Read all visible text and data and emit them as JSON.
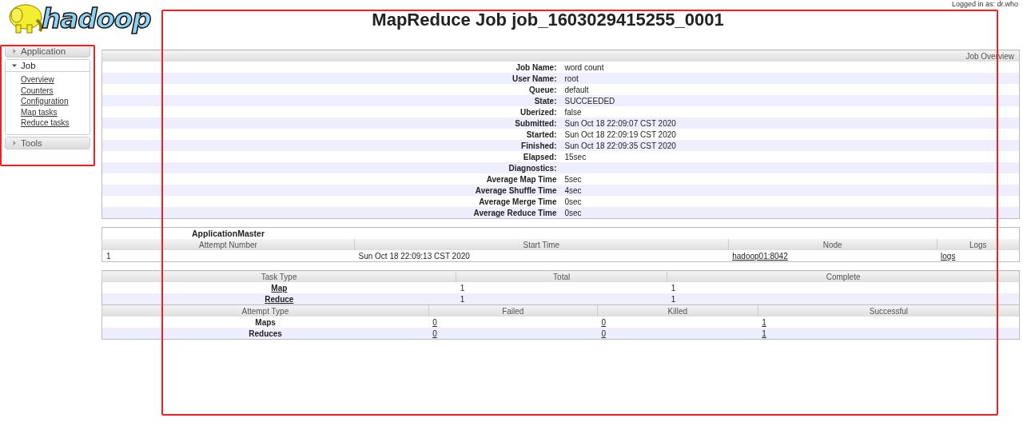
{
  "logo": {
    "text": "hadoop"
  },
  "user": {
    "text": "Logged in as: dr.who"
  },
  "title": "MapReduce Job job_1603029415255_0001",
  "sidebar": [
    {
      "label": "Application",
      "expanded": false
    },
    {
      "label": "Job",
      "expanded": true,
      "children": [
        {
          "label": "Overview"
        },
        {
          "label": "Counters"
        },
        {
          "label": "Configuration"
        },
        {
          "label": "Map tasks"
        },
        {
          "label": "Reduce tasks"
        }
      ]
    },
    {
      "label": "Tools",
      "expanded": false
    }
  ],
  "overview": {
    "title": "Job Overview",
    "rows": [
      {
        "label": "Job Name:",
        "value": "word count"
      },
      {
        "label": "User Name:",
        "value": "root"
      },
      {
        "label": "Queue:",
        "value": "default"
      },
      {
        "label": "State:",
        "value": "SUCCEEDED"
      },
      {
        "label": "Uberized:",
        "value": "false"
      },
      {
        "label": "Submitted:",
        "value": "Sun Oct 18 22:09:07 CST 2020"
      },
      {
        "label": "Started:",
        "value": "Sun Oct 18 22:09:19 CST 2020"
      },
      {
        "label": "Finished:",
        "value": "Sun Oct 18 22:09:35 CST 2020"
      },
      {
        "label": "Elapsed:",
        "value": "15sec"
      },
      {
        "label": "Diagnostics:"
      },
      {
        "label": "Average Map Time",
        "value": "5sec"
      },
      {
        "label": "Average Shuffle Time",
        "value": "4sec"
      },
      {
        "label": "Average Merge Time",
        "value": "0sec"
      },
      {
        "label": "Average Reduce Time",
        "value": "0sec"
      }
    ]
  },
  "application_master": {
    "caption": "ApplicationMaster",
    "columns": [
      "Attempt Number",
      "Start Time",
      "Node",
      "Logs"
    ],
    "rows": [
      [
        {
          "kind": "value",
          "text": "1",
          "link": false
        },
        {
          "kind": "value",
          "text": "Sun Oct 18 22:09:13 CST 2020",
          "link": false
        },
        {
          "kind": "value",
          "text": "hadoop01:8042",
          "link": true
        },
        {
          "kind": "value",
          "text": "logs",
          "link": true
        }
      ]
    ]
  },
  "tasks": {
    "columns": [
      "Task Type",
      "Total",
      "Complete"
    ],
    "rows": [
      [
        {
          "kind": "type",
          "text": "Map",
          "link": true
        },
        {
          "kind": "value",
          "text": "1",
          "link": false
        },
        {
          "kind": "value",
          "text": "1",
          "link": false
        }
      ],
      [
        {
          "kind": "type",
          "text": "Reduce",
          "link": true
        },
        {
          "kind": "value",
          "text": "1",
          "link": false
        },
        {
          "kind": "value",
          "text": "1",
          "link": false
        }
      ]
    ]
  },
  "attempts": {
    "columns": [
      "Attempt Type",
      "Failed",
      "Killed",
      "Successful"
    ],
    "rows": [
      [
        {
          "kind": "type",
          "text": "Maps",
          "link": false
        },
        {
          "kind": "value",
          "text": "0",
          "link": true
        },
        {
          "kind": "value",
          "text": "0",
          "link": true
        },
        {
          "kind": "value",
          "text": "1",
          "link": true
        }
      ],
      [
        {
          "kind": "type",
          "text": "Reduces",
          "link": false
        },
        {
          "kind": "value",
          "text": "0",
          "link": true
        },
        {
          "kind": "value",
          "text": "0",
          "link": true
        },
        {
          "kind": "value",
          "text": "1",
          "link": true
        }
      ]
    ]
  },
  "annotations": {
    "sidebar_box": true,
    "main_box": true
  }
}
